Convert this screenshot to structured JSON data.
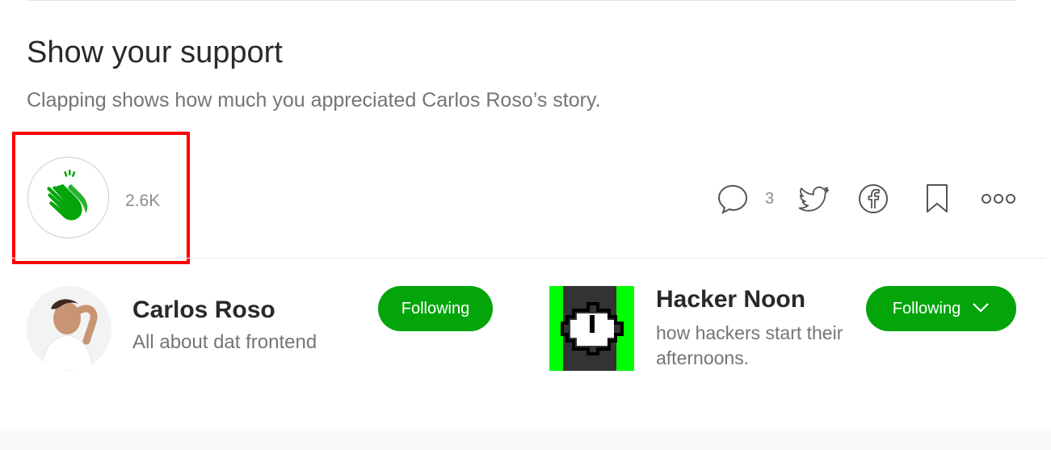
{
  "support": {
    "title": "Show your support",
    "subtitle": "Clapping shows how much you appreciated Carlos Roso’s story."
  },
  "clap": {
    "count": "2.6K",
    "icon": "clap-hands-icon",
    "color": "#03a50b",
    "highlight_color": "#ff0000"
  },
  "actions": {
    "responses_count": "3",
    "icons": [
      "comment-bubble-icon",
      "twitter-icon",
      "facebook-icon",
      "bookmark-icon",
      "more-options-icon"
    ]
  },
  "author": {
    "name": "Carlos Roso",
    "bio": "All about dat frontend",
    "follow_label": "Following"
  },
  "publication": {
    "name": "Hacker Noon",
    "description": "how hackers start their afternoons.",
    "follow_label": "Following",
    "logo_color": "#00ff00"
  },
  "colors": {
    "accent": "#03a50b",
    "text_primary": "#292929",
    "text_secondary": "#757575"
  }
}
